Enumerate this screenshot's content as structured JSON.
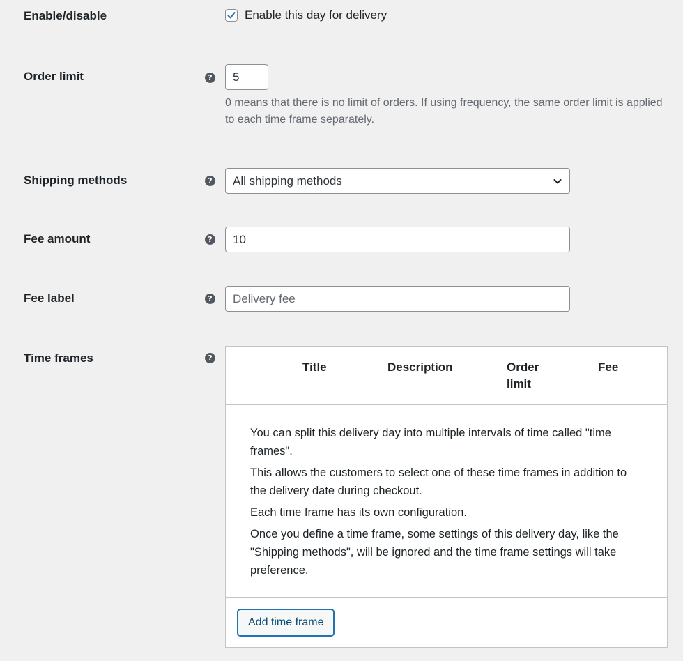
{
  "enable": {
    "label": "Enable/disable",
    "checkbox_label": "Enable this day for delivery",
    "checked": true
  },
  "order_limit": {
    "label": "Order limit",
    "value": "5",
    "description": "0 means that there is no limit of orders. If using frequency, the same order limit is applied to each time frame separately."
  },
  "shipping_methods": {
    "label": "Shipping methods",
    "selected": "All shipping methods"
  },
  "fee_amount": {
    "label": "Fee amount",
    "value": "10"
  },
  "fee_label": {
    "label": "Fee label",
    "placeholder": "Delivery fee"
  },
  "time_frames": {
    "label": "Time frames",
    "columns": [
      "Title",
      "Description",
      "Order\nlimit",
      "Fee"
    ],
    "empty_text": [
      "You can split this delivery day into multiple intervals of time called \"time frames\".",
      "This allows the customers to select one of these time frames in addition to the delivery date during checkout.",
      "Each time frame has its own configuration.",
      "Once you define a time frame, some settings of this delivery day, like the \"Shipping methods\", will be ignored and the time frame settings will take preference."
    ],
    "add_button": "Add time frame"
  },
  "help_icon_glyph": "?",
  "colors": {
    "accent": "#2271b1",
    "background": "#f0f0f1"
  }
}
